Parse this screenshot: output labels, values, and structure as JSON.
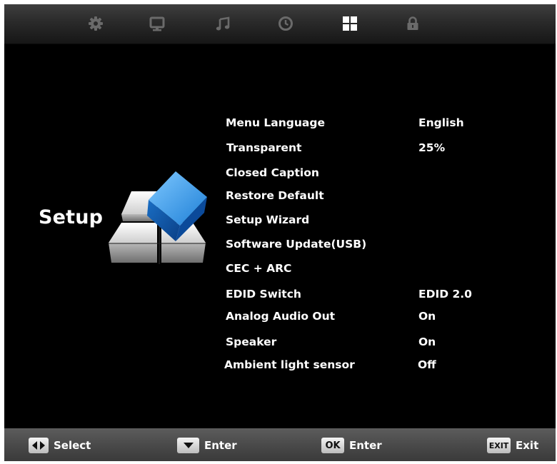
{
  "top_tabs": [
    {
      "icon": "gear-icon",
      "label": ""
    },
    {
      "icon": "monitor-icon",
      "label": ""
    },
    {
      "icon": "music-note-icon",
      "label": ""
    },
    {
      "icon": "clock-icon",
      "label": ""
    },
    {
      "icon": "grid-icon",
      "label": "",
      "active": true
    },
    {
      "icon": "lock-icon",
      "label": ""
    }
  ],
  "colors": {
    "active_icon": "#ffffff",
    "inactive_icon": "#6a6a6a",
    "background": "#000000"
  },
  "section": {
    "title": "Setup",
    "icon": "setup-cube-icon"
  },
  "menu": [
    {
      "label": "Menu Language",
      "value": "English"
    },
    {
      "label": "Transparent",
      "value": "25%"
    },
    {
      "label": "Closed Caption",
      "value": ""
    },
    {
      "label": "Restore Default",
      "value": ""
    },
    {
      "label": "Setup Wizard",
      "value": ""
    },
    {
      "label": "Software Update(USB)",
      "value": ""
    },
    {
      "label": "CEC + ARC",
      "value": ""
    },
    {
      "label": "EDID Switch",
      "value": "EDID 2.0"
    },
    {
      "label": "Analog Audio Out",
      "value": "On"
    },
    {
      "label": "Speaker",
      "value": "On"
    },
    {
      "label": "Ambient light sensor",
      "value": "Off"
    }
  ],
  "footer": {
    "select": {
      "key_icon": "left-right-arrows-icon",
      "label": "Select"
    },
    "enter_down": {
      "key_icon": "down-arrow-icon",
      "label": "Enter"
    },
    "enter_ok": {
      "key_text": "OK",
      "label": "Enter"
    },
    "exit": {
      "key_text": "EXIT",
      "label": "Exit"
    }
  }
}
